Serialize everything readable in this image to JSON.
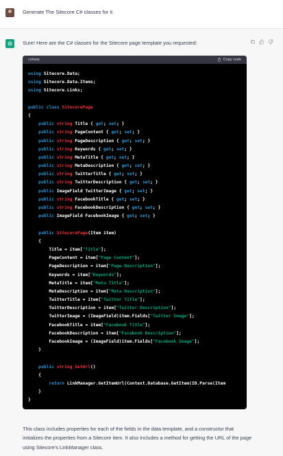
{
  "user": {
    "message": "Generate The Sitecore C# classes for it"
  },
  "assistant": {
    "intro": "Sure! Here are the C# classes for the Sitecore page template you requested:",
    "code_language": "csharp",
    "copy_label": "Copy code",
    "code_lines": [
      [
        [
          "kw",
          "using"
        ],
        [
          "pl",
          " Sitecore.Data;"
        ]
      ],
      [
        [
          "kw",
          "using"
        ],
        [
          "pl",
          " Sitecore.Data.Items;"
        ]
      ],
      [
        [
          "kw",
          "using"
        ],
        [
          "pl",
          " Sitecore.Links;"
        ]
      ],
      [],
      [
        [
          "kw",
          "public"
        ],
        [
          "pl",
          " "
        ],
        [
          "kw",
          "class"
        ],
        [
          "pl",
          " "
        ],
        [
          "ty",
          "SitecorePage"
        ]
      ],
      [
        [
          "pl",
          "{"
        ]
      ],
      [
        [
          "pl",
          "    "
        ],
        [
          "kw",
          "public"
        ],
        [
          "pl",
          " "
        ],
        [
          "ty",
          "string"
        ],
        [
          "pl",
          " Title { "
        ],
        [
          "kw",
          "get"
        ],
        [
          "pl",
          "; "
        ],
        [
          "kw",
          "set"
        ],
        [
          "pl",
          "; }"
        ]
      ],
      [
        [
          "pl",
          "    "
        ],
        [
          "kw",
          "public"
        ],
        [
          "pl",
          " "
        ],
        [
          "ty",
          "string"
        ],
        [
          "pl",
          " PageContent { "
        ],
        [
          "kw",
          "get"
        ],
        [
          "pl",
          "; "
        ],
        [
          "kw",
          "set"
        ],
        [
          "pl",
          "; }"
        ]
      ],
      [
        [
          "pl",
          "    "
        ],
        [
          "kw",
          "public"
        ],
        [
          "pl",
          " "
        ],
        [
          "ty",
          "string"
        ],
        [
          "pl",
          " PageDescription { "
        ],
        [
          "kw",
          "get"
        ],
        [
          "pl",
          "; "
        ],
        [
          "kw",
          "set"
        ],
        [
          "pl",
          "; }"
        ]
      ],
      [
        [
          "pl",
          "    "
        ],
        [
          "kw",
          "public"
        ],
        [
          "pl",
          " "
        ],
        [
          "ty",
          "string"
        ],
        [
          "pl",
          " Keywords { "
        ],
        [
          "kw",
          "get"
        ],
        [
          "pl",
          "; "
        ],
        [
          "kw",
          "set"
        ],
        [
          "pl",
          "; }"
        ]
      ],
      [
        [
          "pl",
          "    "
        ],
        [
          "kw",
          "public"
        ],
        [
          "pl",
          " "
        ],
        [
          "ty",
          "string"
        ],
        [
          "pl",
          " MetaTitle { "
        ],
        [
          "kw",
          "get"
        ],
        [
          "pl",
          "; "
        ],
        [
          "kw",
          "set"
        ],
        [
          "pl",
          "; }"
        ]
      ],
      [
        [
          "pl",
          "    "
        ],
        [
          "kw",
          "public"
        ],
        [
          "pl",
          " "
        ],
        [
          "ty",
          "string"
        ],
        [
          "pl",
          " MetaDescription { "
        ],
        [
          "kw",
          "get"
        ],
        [
          "pl",
          "; "
        ],
        [
          "kw",
          "set"
        ],
        [
          "pl",
          "; }"
        ]
      ],
      [
        [
          "pl",
          "    "
        ],
        [
          "kw",
          "public"
        ],
        [
          "pl",
          " "
        ],
        [
          "ty",
          "string"
        ],
        [
          "pl",
          " TwitterTitle { "
        ],
        [
          "kw",
          "get"
        ],
        [
          "pl",
          "; "
        ],
        [
          "kw",
          "set"
        ],
        [
          "pl",
          "; }"
        ]
      ],
      [
        [
          "pl",
          "    "
        ],
        [
          "kw",
          "public"
        ],
        [
          "pl",
          " "
        ],
        [
          "ty",
          "string"
        ],
        [
          "pl",
          " TwitterDescription { "
        ],
        [
          "kw",
          "get"
        ],
        [
          "pl",
          "; "
        ],
        [
          "kw",
          "set"
        ],
        [
          "pl",
          "; }"
        ]
      ],
      [
        [
          "pl",
          "    "
        ],
        [
          "kw",
          "public"
        ],
        [
          "pl",
          " ImageField TwitterImage { "
        ],
        [
          "kw",
          "get"
        ],
        [
          "pl",
          "; "
        ],
        [
          "kw",
          "set"
        ],
        [
          "pl",
          "; }"
        ]
      ],
      [
        [
          "pl",
          "    "
        ],
        [
          "kw",
          "public"
        ],
        [
          "pl",
          " "
        ],
        [
          "ty",
          "string"
        ],
        [
          "pl",
          " FacebookTitle { "
        ],
        [
          "kw",
          "get"
        ],
        [
          "pl",
          "; "
        ],
        [
          "kw",
          "set"
        ],
        [
          "pl",
          "; }"
        ]
      ],
      [
        [
          "pl",
          "    "
        ],
        [
          "kw",
          "public"
        ],
        [
          "pl",
          " "
        ],
        [
          "ty",
          "string"
        ],
        [
          "pl",
          " FacebookDescription { "
        ],
        [
          "kw",
          "get"
        ],
        [
          "pl",
          "; "
        ],
        [
          "kw",
          "set"
        ],
        [
          "pl",
          "; }"
        ]
      ],
      [
        [
          "pl",
          "    "
        ],
        [
          "kw",
          "public"
        ],
        [
          "pl",
          " ImageField FacebookImage { "
        ],
        [
          "kw",
          "get"
        ],
        [
          "pl",
          "; "
        ],
        [
          "kw",
          "set"
        ],
        [
          "pl",
          "; }"
        ]
      ],
      [],
      [
        [
          "pl",
          "    "
        ],
        [
          "kw",
          "public"
        ],
        [
          "pl",
          " "
        ],
        [
          "ty",
          "SitecorePage"
        ],
        [
          "pl",
          "(Item item)"
        ]
      ],
      [
        [
          "pl",
          "    {"
        ]
      ],
      [
        [
          "pl",
          "        Title = item["
        ],
        [
          "str",
          "\"Title\""
        ],
        [
          "pl",
          "];"
        ]
      ],
      [
        [
          "pl",
          "        PageContent = item["
        ],
        [
          "str",
          "\"Page Content\""
        ],
        [
          "pl",
          "];"
        ]
      ],
      [
        [
          "pl",
          "        PageDescription = item["
        ],
        [
          "str",
          "\"Page Description\""
        ],
        [
          "pl",
          "];"
        ]
      ],
      [
        [
          "pl",
          "        Keywords = item["
        ],
        [
          "str",
          "\"Keywords\""
        ],
        [
          "pl",
          "];"
        ]
      ],
      [
        [
          "pl",
          "        MetaTitle = item["
        ],
        [
          "str",
          "\"Meta Title\""
        ],
        [
          "pl",
          "];"
        ]
      ],
      [
        [
          "pl",
          "        MetaDescription = item["
        ],
        [
          "str",
          "\"Meta Description\""
        ],
        [
          "pl",
          "];"
        ]
      ],
      [
        [
          "pl",
          "        TwitterTitle = item["
        ],
        [
          "str",
          "\"Twitter Title\""
        ],
        [
          "pl",
          "];"
        ]
      ],
      [
        [
          "pl",
          "        TwitterDescription = item["
        ],
        [
          "str",
          "\"Twitter Description\""
        ],
        [
          "pl",
          "];"
        ]
      ],
      [
        [
          "pl",
          "        TwitterImage = (ImageField)item.Fields["
        ],
        [
          "str",
          "\"Twitter Image\""
        ],
        [
          "pl",
          "];"
        ]
      ],
      [
        [
          "pl",
          "        FacebookTitle = item["
        ],
        [
          "str",
          "\"Facebook Title\""
        ],
        [
          "pl",
          "];"
        ]
      ],
      [
        [
          "pl",
          "        FacebookDescription = item["
        ],
        [
          "str",
          "\"Facebook Description\""
        ],
        [
          "pl",
          "];"
        ]
      ],
      [
        [
          "pl",
          "        FacebookImage = (ImageField)item.Fields["
        ],
        [
          "str",
          "\"Facebook Image\""
        ],
        [
          "pl",
          "];"
        ]
      ],
      [
        [
          "pl",
          "    }"
        ]
      ],
      [],
      [
        [
          "pl",
          "    "
        ],
        [
          "kw",
          "public"
        ],
        [
          "pl",
          " "
        ],
        [
          "ty",
          "string"
        ],
        [
          "pl",
          " "
        ],
        [
          "ty",
          "GetUrl"
        ],
        [
          "pl",
          "()"
        ]
      ],
      [
        [
          "pl",
          "    {"
        ]
      ],
      [
        [
          "pl",
          "        "
        ],
        [
          "kw",
          "return"
        ],
        [
          "pl",
          " LinkManager.GetItemUrl(Context.Database.GetItem(ID.Parse(Item"
        ]
      ],
      [
        [
          "pl",
          "    }"
        ]
      ],
      [
        [
          "pl",
          "}"
        ]
      ]
    ],
    "summary": "This class includes properties for each of the fields in the data template, and a constructor that initializes the properties from a Sitecore item. It also includes a method for getting the URL of the page using Sitecore's LinkManager class."
  },
  "icons": {
    "user_avatar": "user-avatar-photo",
    "gpt_avatar": "openai-logo",
    "actions": [
      "copy-icon",
      "thumbs-up-icon",
      "thumbs-down-icon"
    ],
    "copy": "clipboard-icon"
  },
  "colors": {
    "keyword": "#2e95d3",
    "type": "#f22c3d",
    "string": "#00a67d",
    "code_bg": "#000000",
    "header_bg": "#343541",
    "brand": "#10a37f"
  }
}
